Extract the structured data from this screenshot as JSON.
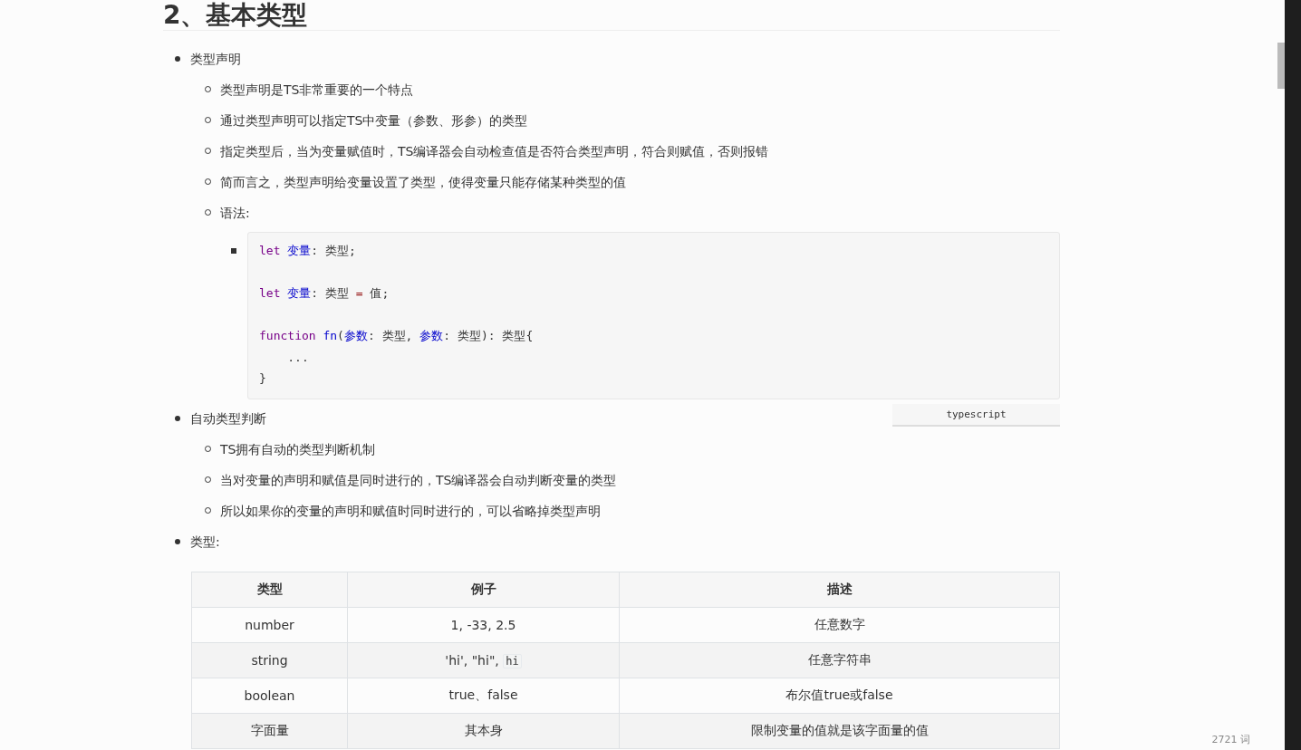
{
  "heading": "2、基本类型",
  "sections": [
    {
      "label": "类型声明",
      "items": [
        {
          "text": "类型声明是TS非常重要的一个特点"
        },
        {
          "text": "通过类型声明可以指定TS中变量（参数、形参）的类型"
        },
        {
          "text": "指定类型后，当为变量赋值时，TS编译器会自动检查值是否符合类型声明，符合则赋值，否则报错"
        },
        {
          "text": "简而言之，类型声明给变量设置了类型，使得变量只能存储某种类型的值"
        },
        {
          "text": "语法:",
          "code": {
            "language": "typescript",
            "lines": [
              {
                "blank_before": false,
                "tokens": [
                  {
                    "kind": "keyword",
                    "text": "let"
                  },
                  {
                    "kind": "variable",
                    "text": "变量",
                    "space_before": true
                  },
                  {
                    "kind": "plain",
                    "text": ": 类型;"
                  }
                ]
              },
              {
                "blank_before": true,
                "tokens": [
                  {
                    "kind": "keyword",
                    "text": "let"
                  },
                  {
                    "kind": "variable",
                    "text": "变量",
                    "space_before": true
                  },
                  {
                    "kind": "plain",
                    "text": ": 类型"
                  },
                  {
                    "kind": "operator",
                    "text": "=",
                    "space_before": true
                  },
                  {
                    "kind": "plain",
                    "text": "值;",
                    "space_before": true
                  }
                ]
              },
              {
                "blank_before": true,
                "tokens": [
                  {
                    "kind": "keyword",
                    "text": "function"
                  },
                  {
                    "kind": "function",
                    "text": "fn",
                    "space_before": true
                  },
                  {
                    "kind": "plain",
                    "text": "("
                  },
                  {
                    "kind": "variable",
                    "text": "参数"
                  },
                  {
                    "kind": "plain",
                    "text": ": 类型, "
                  },
                  {
                    "kind": "variable",
                    "text": "参数"
                  },
                  {
                    "kind": "plain",
                    "text": ": 类型): 类型{"
                  }
                ]
              },
              {
                "blank_before": false,
                "tokens": [
                  {
                    "kind": "plain",
                    "text": "..."
                  }
                ],
                "indent": true
              },
              {
                "blank_before": false,
                "tokens": [
                  {
                    "kind": "plain",
                    "text": "}"
                  }
                ]
              }
            ]
          }
        }
      ]
    },
    {
      "label": "自动类型判断",
      "items": [
        {
          "text": "TS拥有自动的类型判断机制"
        },
        {
          "text": "当对变量的声明和赋值是同时进行的，TS编译器会自动判断变量的类型"
        },
        {
          "text": "所以如果你的变量的声明和赋值时同时进行的，可以省略掉类型声明"
        }
      ]
    },
    {
      "label": "类型:"
    }
  ],
  "table": {
    "columns": [
      "类型",
      "例子",
      "描述"
    ],
    "rows": [
      {
        "type": "number",
        "example": "1, -33, 2.5",
        "description": "任意数字"
      },
      {
        "type": "string",
        "example": "'hi', \"hi\", ",
        "example_code": "hi",
        "description": "任意字符串"
      },
      {
        "type": "boolean",
        "example": "true、false",
        "description": "布尔值true或false"
      },
      {
        "type": "字面量",
        "example": "其本身",
        "description": "限制变量的值就是该字面量的值"
      }
    ]
  },
  "status_bar": {
    "word_count": "2721 词"
  }
}
